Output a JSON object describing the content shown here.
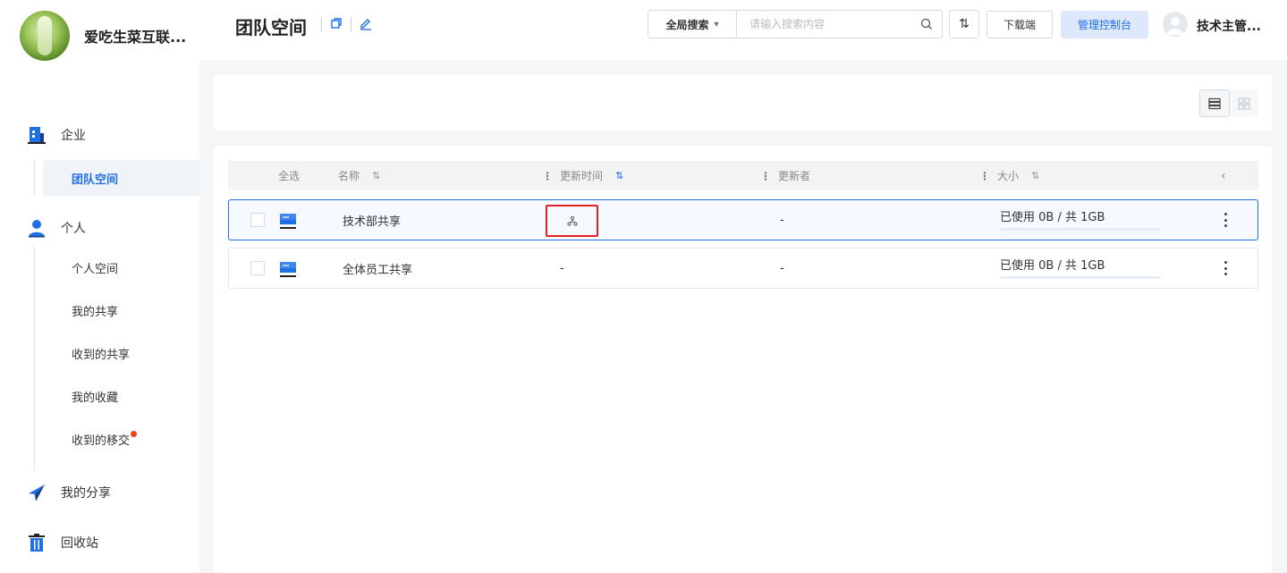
{
  "app": {
    "brand_name": "爱吃生菜互联...",
    "user_name": "技术主管..."
  },
  "sidebar": {
    "enterprise_label": "企业",
    "enterprise_items": [
      "团队空间"
    ],
    "personal_label": "个人",
    "personal_items": [
      "个人空间",
      "我的共享",
      "收到的共享",
      "我的收藏",
      "收到的移交"
    ],
    "my_share_label": "我的分享",
    "recycle_label": "回收站"
  },
  "header": {
    "title": "团队空间",
    "search_scope": "全局搜索",
    "search_placeholder": "请输入搜索内容",
    "sort_glyph": "⇅",
    "download_label": "下载端",
    "admin_label": "管理控制台"
  },
  "table": {
    "columns": {
      "select_all": "全选",
      "name": "名称",
      "updated": "更新时间",
      "updater": "更新者",
      "size": "大小"
    },
    "collapse_glyph": "‹",
    "rows": [
      {
        "name": "技术部共享",
        "updated": "",
        "updater": "-",
        "usage": "已使用 0B / 共 1GB",
        "usage_fraction": 0
      },
      {
        "name": "全体员工共享",
        "updated": "-",
        "updater": "-",
        "usage": "已使用 0B / 共 1GB",
        "usage_fraction": 0
      }
    ]
  },
  "colors": {
    "accent": "#1f6fe5",
    "highlight_box": "#e02424",
    "notification_dot": "#e8421f"
  }
}
